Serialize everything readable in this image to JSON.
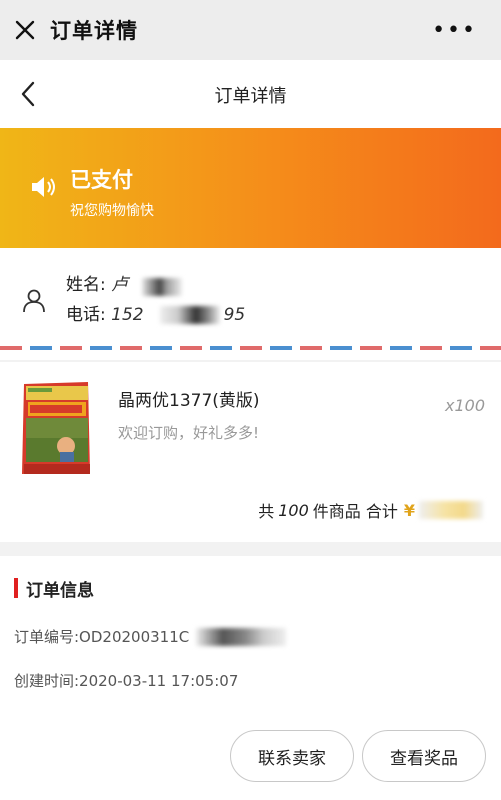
{
  "wechat": {
    "title": "订单详情",
    "close_icon": "close-icon",
    "more_icon": "more-icon",
    "more_label": "•••"
  },
  "nav": {
    "title": "订单详情",
    "back_icon": "chevron-left-icon"
  },
  "status": {
    "title": "已支付",
    "subtitle": "祝您购物愉快",
    "icon": "speaker-icon",
    "gradient": [
      "#f0b617",
      "#f36a1c"
    ]
  },
  "address": {
    "icon": "user-icon",
    "name_label": "姓名:",
    "name_value": "卢",
    "phone_label": "电话:",
    "phone_value_start": "152",
    "phone_value_end": "95"
  },
  "product": {
    "name": "晶两优1377(黄版)",
    "promo": "欢迎订购，好礼多多!",
    "qty": "x100",
    "summary_prefix": "共",
    "summary_count": "100",
    "summary_mid": "件商品 合计",
    "currency": "¥"
  },
  "order_info": {
    "title": "订单信息",
    "order_no": "订单编号:OD20200311C",
    "created": "创建时间:2020-03-11 17:05:07"
  },
  "actions": {
    "contact_seller": "联系卖家",
    "view_prize": "查看奖品"
  },
  "colors": {
    "accent_red": "#e02020",
    "yen": "#e0a31a"
  }
}
